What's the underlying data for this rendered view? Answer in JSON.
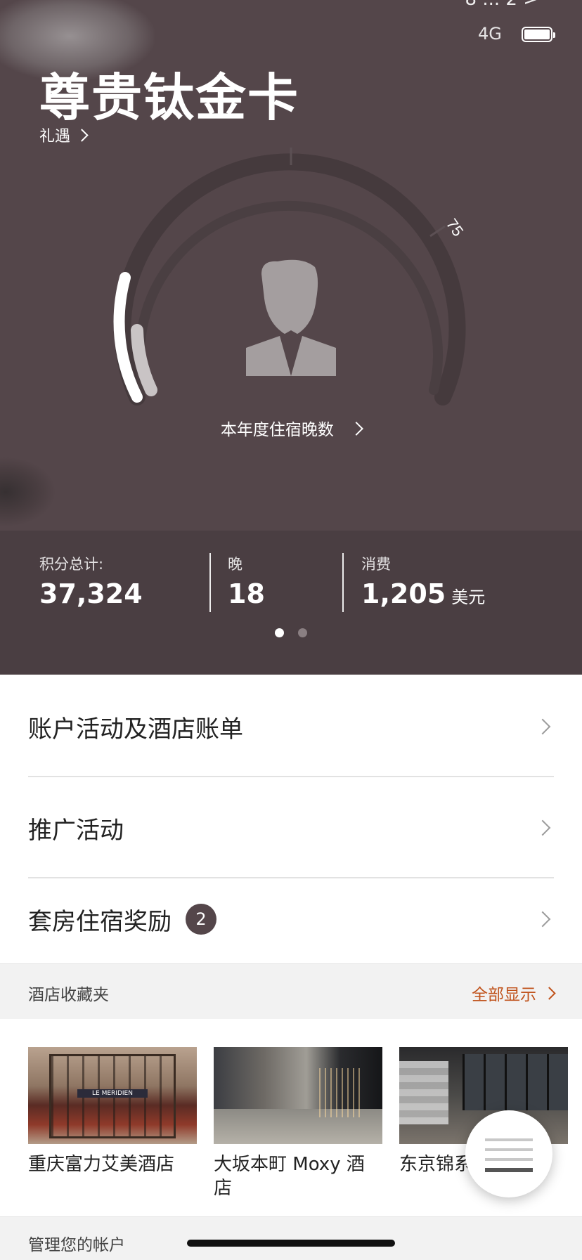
{
  "status_bar": {
    "carrier": "8 ... 2 >",
    "network": "4G",
    "battery_icon": "battery-icon"
  },
  "hero": {
    "tier_title": "尊贵钛金卡",
    "benefits_label": "礼遇",
    "gauge_marker_label": "75",
    "nights_link_label": "本年度住宿晚数",
    "avatar_icon": "member-avatar-icon"
  },
  "stats": {
    "points_label": "积分总计:",
    "points_value": "37,324",
    "nights_label": "晚",
    "nights_value": "18",
    "spend_label": "消费",
    "spend_value": "1,205",
    "spend_unit": "美元",
    "page_count": 2,
    "active_page": 1
  },
  "menu": [
    {
      "label": "账户活动及酒店账单"
    },
    {
      "label": "推广活动"
    },
    {
      "label": "套房住宿奖励",
      "badge": "2"
    }
  ],
  "favorites": {
    "title": "酒店收藏夹",
    "show_all": "全部显示",
    "hotels": [
      {
        "name": "重庆富力艾美酒店",
        "image_sign": "LE MERIDIEN"
      },
      {
        "name": "大坂本町 Moxy 酒店"
      },
      {
        "name": "东京锦系町 酒店"
      }
    ]
  },
  "manage": {
    "title": "管理您的帐户"
  },
  "colors": {
    "hero_bg": "#54464a",
    "accent": "#c0531c",
    "badge_bg": "#54464a"
  }
}
